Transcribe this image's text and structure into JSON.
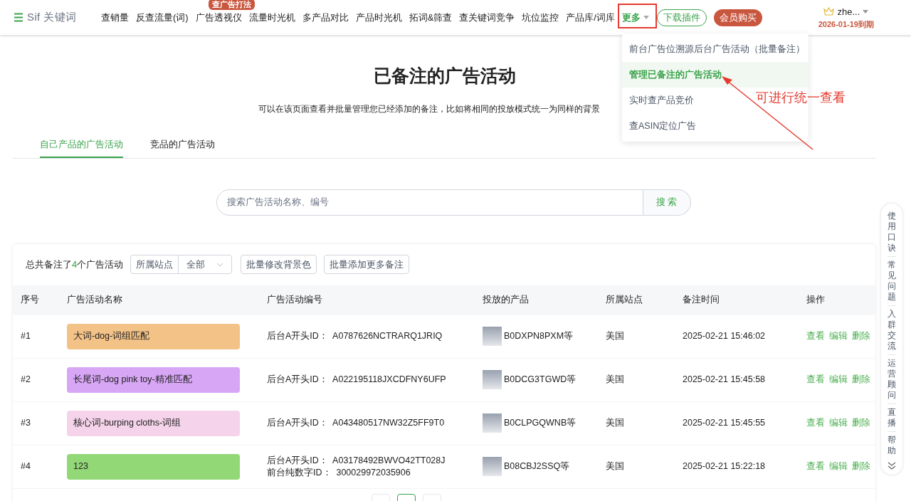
{
  "logo": {
    "text": "Sif 关键词"
  },
  "nav": [
    {
      "label": "查销量",
      "selected": false
    },
    {
      "label": "反查流量(词)",
      "selected": false
    },
    {
      "label": "广告透视仪",
      "selected": false,
      "badge": "查广告打法"
    },
    {
      "label": "流量时光机",
      "selected": false
    },
    {
      "label": "多产品对比",
      "selected": false
    },
    {
      "label": "产品时光机",
      "selected": false
    },
    {
      "label": "拓词&筛查",
      "selected": false
    },
    {
      "label": "查关键词竞争",
      "selected": false
    },
    {
      "label": "坑位监控",
      "selected": false
    },
    {
      "label": "产品库/词库",
      "selected": false
    },
    {
      "label": "更多",
      "selected": true,
      "has_menu": true
    }
  ],
  "download_button": "下载插件",
  "member_button": "会员购买",
  "user": {
    "name": "zhe...",
    "expiry": "2026-01-19到期"
  },
  "dropdown": [
    {
      "label": "前台广告位溯源后台广告活动（批量备注）",
      "selected": false
    },
    {
      "label": "管理已备注的广告活动",
      "selected": true
    },
    {
      "label": "实时查产品竞价",
      "selected": false
    },
    {
      "label": "查ASIN定位广告",
      "selected": false
    }
  ],
  "annotation": {
    "text": "可进行统一查看"
  },
  "title": "已备注的广告活动",
  "subtitle": "可以在该页面查看并批量管理您已经添加的备注，比如将相同的投放模式统一为同样的背景",
  "tabs": [
    {
      "label": "自己产品的广告活动",
      "selected": true
    },
    {
      "label": "竞品的广告活动",
      "selected": false
    }
  ],
  "search": {
    "placeholder": "搜索广告活动名称、编号",
    "button": "搜 索"
  },
  "summary": "总共备注了**4**个广告活动",
  "site_filter": {
    "label": "所属站点",
    "value": "全部"
  },
  "actions": [
    "批量修改背景色",
    "批量添加更多备注"
  ],
  "table": {
    "columns": [
      "序号",
      "广告活动名称",
      "广告活动编号",
      "投放的产品",
      "所属站点",
      "备注时间",
      "操作"
    ],
    "rows": [
      {
        "index": "#1",
        "name": "大词-dog-词组匹配",
        "color": "#f3c287",
        "ids": [
          "后台A开头ID：  A0787626NCTRARQ1JRIQ"
        ],
        "product": "B0DXPN8PXM等",
        "site": "美国",
        "time": "2025-02-21 15:46:02",
        "ops": [
          "查看",
          "编辑",
          "删除"
        ]
      },
      {
        "index": "#2",
        "name": "长尾词-dog pink toy-精准匹配",
        "color": "#d7a6f5",
        "ids": [
          "后台A开头ID：  A022195118JXCDFNY6UFP"
        ],
        "product": "B0DCG3TGWD等",
        "site": "美国",
        "time": "2025-02-21 15:45:58",
        "ops": [
          "查看",
          "编辑",
          "删除"
        ]
      },
      {
        "index": "#3",
        "name": "核心词-burping cloths-词组",
        "color": "#f5d3ea",
        "ids": [
          "后台A开头ID：  A043480517NW32Z5FF9T0"
        ],
        "product": "B0CLPGQWNB等",
        "site": "美国",
        "time": "2025-02-21 15:45:55",
        "ops": [
          "查看",
          "编辑",
          "删除"
        ]
      },
      {
        "index": "#4",
        "name": "123",
        "color": "#92d877",
        "ids": [
          "后台A开头ID：  A03178492BWVO42TT028J",
          "前台纯数字ID：  300029972035906"
        ],
        "product": "B08CBJ2SSQ等",
        "site": "美国",
        "time": "2025-02-21 15:22:18",
        "ops": [
          "查看",
          "编辑",
          "删除"
        ]
      }
    ]
  },
  "side_tools": [
    "使用口诀",
    "常见问题",
    "入群交流",
    "运营顾问",
    "直播",
    "帮助"
  ]
}
